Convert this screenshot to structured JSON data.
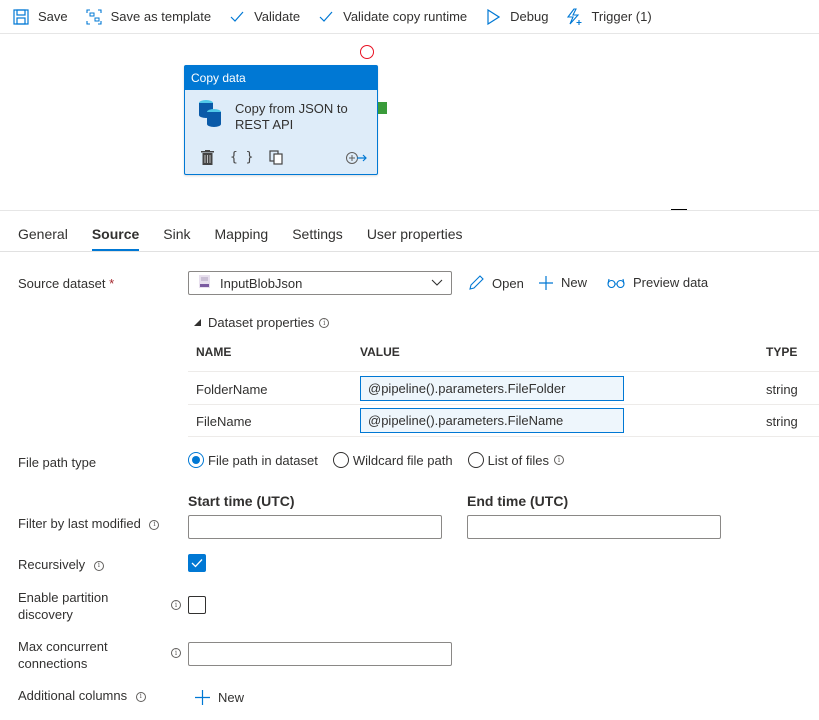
{
  "toolbar": {
    "items": [
      {
        "label": "Save",
        "icon": "save-icon"
      },
      {
        "label": "Save as template",
        "icon": "save-template-icon"
      },
      {
        "label": "Validate",
        "icon": "checkmark-icon"
      },
      {
        "label": "Validate copy runtime",
        "icon": "checkmark-icon"
      },
      {
        "label": "Debug",
        "icon": "play-icon"
      },
      {
        "label": "Trigger (1)",
        "icon": "trigger-icon"
      }
    ]
  },
  "activity": {
    "type": "Copy data",
    "name": "Copy from JSON to REST API",
    "accent": "#0078d4"
  },
  "tabs": [
    {
      "label": "General",
      "active": false
    },
    {
      "label": "Source",
      "active": true
    },
    {
      "label": "Sink",
      "active": false
    },
    {
      "label": "Mapping",
      "active": false
    },
    {
      "label": "Settings",
      "active": false
    },
    {
      "label": "User properties",
      "active": false
    }
  ],
  "source": {
    "dataset_label": "Source dataset",
    "required_mark": "*",
    "dataset_value": "InputBlobJson",
    "open_label": "Open",
    "new_label": "New",
    "preview_label": "Preview data",
    "dataset_properties_label": "Dataset properties",
    "table": {
      "headers": [
        "NAME",
        "VALUE",
        "TYPE"
      ],
      "rows": [
        {
          "name": "FolderName",
          "value": "@pipeline().parameters.FileFolder",
          "type": "string"
        },
        {
          "name": "FileName",
          "value": "@pipeline().parameters.FileName",
          "type": "string"
        }
      ]
    },
    "file_path_type_label": "File path type",
    "file_path_options": [
      {
        "label": "File path in dataset",
        "selected": true
      },
      {
        "label": "Wildcard file path",
        "selected": false
      },
      {
        "label": "List of files",
        "selected": false
      }
    ],
    "filter_label": "Filter by last modified",
    "start_time_label": "Start time (UTC)",
    "end_time_label": "End time (UTC)",
    "start_time_value": "",
    "end_time_value": "",
    "recursively_label": "Recursively",
    "recursively_checked": true,
    "partition_label_1": "Enable partition",
    "partition_label_2": "discovery",
    "partition_checked": false,
    "max_conn_label_1": "Max concurrent",
    "max_conn_label_2": "connections",
    "max_conn_value": "",
    "additional_columns_label": "Additional columns",
    "additional_new_label": "New"
  }
}
